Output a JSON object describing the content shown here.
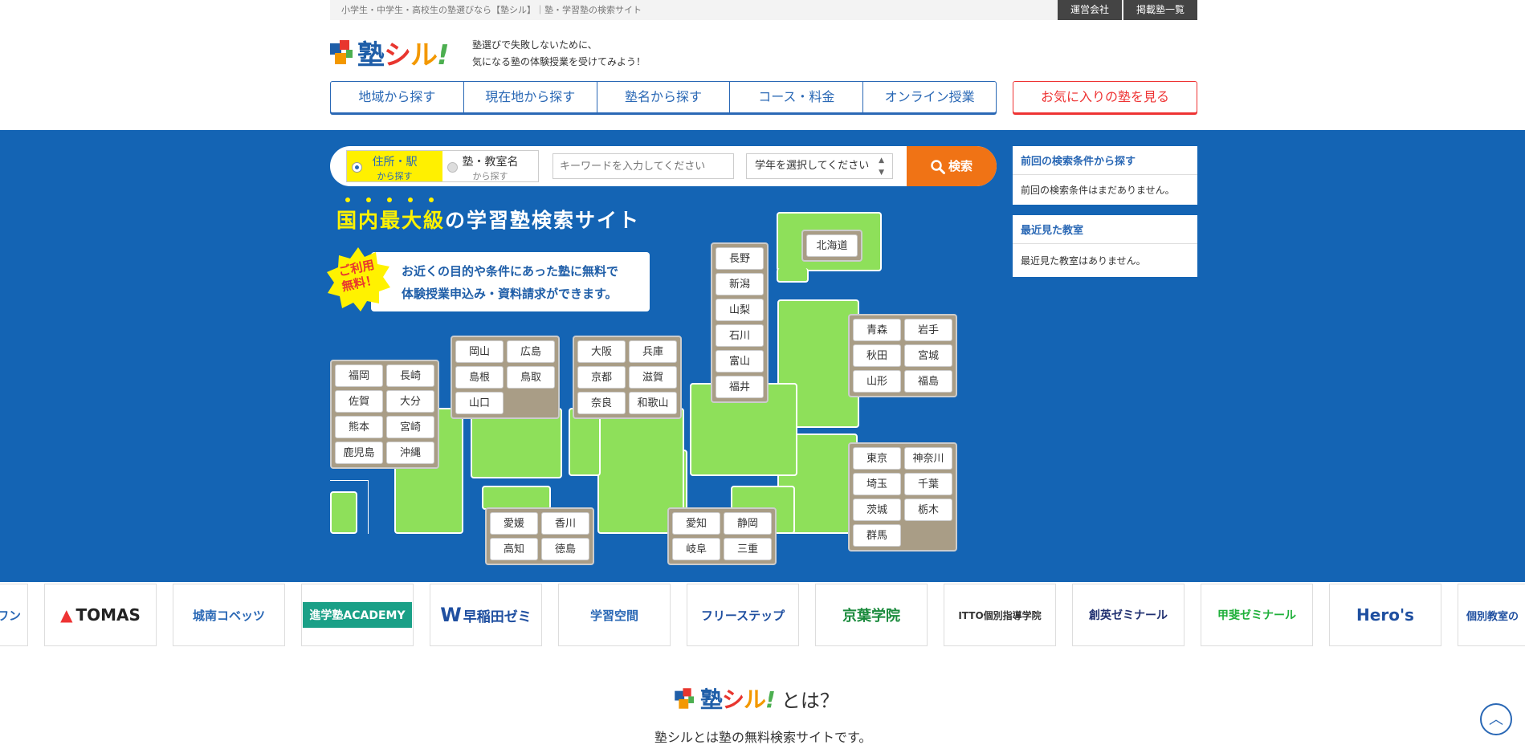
{
  "topbar": {
    "tagline": "小学生・中学生・高校生の塾選びなら【塾シル】｜塾・学習塾の検索サイト",
    "links": [
      "運営会社",
      "掲載塾一覧"
    ]
  },
  "brand": {
    "logo_text_1": "塾",
    "logo_text_2": "シ",
    "logo_text_3": "ル",
    "logo_text_4": "!"
  },
  "header": {
    "copy_line1": "塾選びで失敗しないために、",
    "copy_line2": "気になる塾の体験授業を受けてみよう！"
  },
  "nav": {
    "items": [
      "地域から探す",
      "現在地から探す",
      "塾名から探す",
      "コース・料金",
      "オンライン授業"
    ],
    "favorite": "お気に入りの塾を見る"
  },
  "search": {
    "tab_address": "住所・駅",
    "tab_address_sub": "から探す",
    "tab_school": "塾・教室名",
    "tab_school_sub": "から探す",
    "keyword_placeholder": "キーワードを入力してください",
    "grade_value": "学年を選択してください",
    "button": "検索"
  },
  "sidebar": {
    "prev_title": "前回の検索条件から探す",
    "prev_body": "前回の検索条件はまだありません。",
    "recent_title": "最近見た教室",
    "recent_body": "最近見た教室はありません。"
  },
  "hero": {
    "headline_hl": "国内最大級",
    "headline_rest": "の学習塾検索サイト",
    "badge_line1": "ご利用",
    "badge_line2": "無料！",
    "callout_line1": "お近くの目的や条件にあった塾に無料で",
    "callout_line2": "体験授業申込み・資料請求ができます。"
  },
  "map": {
    "hokkaido": "北海道",
    "chubu_north": [
      "長野",
      "新潟",
      "山梨",
      "石川",
      "富山",
      "福井"
    ],
    "tohoku": [
      "青森",
      "岩手",
      "秋田",
      "宮城",
      "山形",
      "福島"
    ],
    "kanto": [
      "東京",
      "神奈川",
      "埼玉",
      "千葉",
      "茨城",
      "栃木",
      "群馬"
    ],
    "kansai": [
      "大阪",
      "兵庫",
      "京都",
      "滋賀",
      "奈良",
      "和歌山"
    ],
    "chugoku": [
      "岡山",
      "広島",
      "島根",
      "鳥取",
      "山口"
    ],
    "kyushu": [
      "福岡",
      "長崎",
      "佐賀",
      "大分",
      "熊本",
      "宮崎",
      "鹿児島",
      "沖縄"
    ],
    "shikoku": [
      "愛媛",
      "香川",
      "高知",
      "徳島"
    ],
    "tokai": [
      "愛知",
      "静岡",
      "岐阜",
      "三重"
    ]
  },
  "brands": [
    "ワン",
    "TOMAS",
    "城南コベッツ",
    "進学塾ACADEMY",
    "早稲田ゼミ",
    "学習空間",
    "フリーステップ",
    "京葉学院",
    "ITTO個別指導学院",
    "創英ゼミナール",
    "甲斐ゼミナール",
    "Hero's",
    "個別教室の"
  ],
  "about": {
    "title_suffix": "とは？",
    "subtitle": "塾シルとは塾の無料検索サイトです。"
  },
  "colors": {
    "primary": "#1464b4",
    "accent": "#f07315",
    "land": "#8ee05a",
    "highlight": "#fff200",
    "alert": "#e33333"
  }
}
